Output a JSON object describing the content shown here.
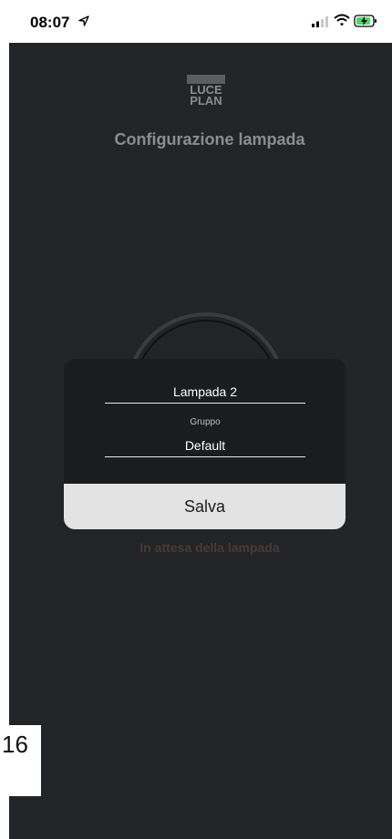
{
  "status_bar": {
    "time": "08:07"
  },
  "logo": {
    "line1": "LUCE",
    "line2": "PLAN"
  },
  "title": "Configurazione lampada",
  "status_message": "In attesa della lampada",
  "dialog": {
    "lamp_name": "Lampada 2",
    "group_label": "Gruppo",
    "group_value": "Default",
    "save_label": "Salva"
  },
  "page_number": "16",
  "icons": [
    "location-arrow-icon",
    "signal-icon",
    "wifi-icon",
    "battery-charging-icon"
  ],
  "colors": {
    "background": "#222427",
    "dialog": "#1b1c1e",
    "button": "#e3e3e3"
  }
}
